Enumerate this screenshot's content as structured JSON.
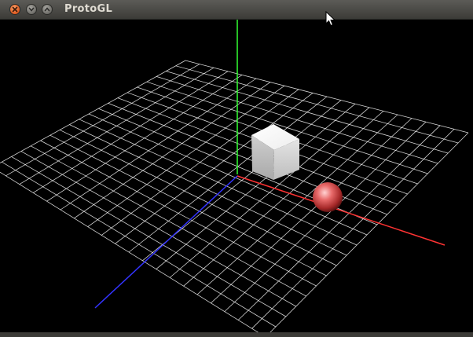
{
  "window": {
    "title": "ProtoGL",
    "controls": {
      "close_icon": "close-icon",
      "minimize_icon": "chevron-down-icon",
      "maximize_icon": "chevron-up-icon"
    }
  },
  "scene": {
    "background_color": "#000000",
    "grid_color": "#ffffff",
    "axes": {
      "x_color": "#ff3333",
      "y_color": "#33ff33",
      "z_color": "#3333ff"
    },
    "objects": [
      {
        "type": "cube",
        "color": "#e8e8e8"
      },
      {
        "type": "sphere",
        "color": "#e65c5c"
      }
    ]
  }
}
